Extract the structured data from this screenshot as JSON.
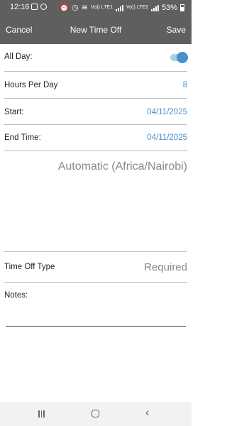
{
  "status_bar": {
    "time": "12:16",
    "battery": "53%",
    "net_label_1": "Vo)) LTE1",
    "net_label_2": "Vo)) LTE2"
  },
  "header": {
    "cancel_label": "Cancel",
    "title": "New Time Off",
    "save_label": "Save"
  },
  "form": {
    "all_day": {
      "label": "All Day:",
      "checked": true
    },
    "hours_per_day": {
      "label": "Hours Per Day",
      "value": "8"
    },
    "start": {
      "label": "Start:",
      "value": "04/11/2025"
    },
    "end": {
      "label": "End Time:",
      "value": "04/11/2025"
    },
    "timezone": "Automatic (Africa/Nairobi)",
    "time_off_type": {
      "label": "Time Off Type",
      "placeholder": "Required"
    },
    "notes": {
      "label": "Notes:",
      "value": ""
    }
  },
  "colors": {
    "header_bg": "#5f5f5f",
    "accent": "#4a90c9",
    "muted_text": "#8a8a8a"
  },
  "icons": {
    "status_left": [
      "image-icon",
      "chat-icon"
    ],
    "status_right": [
      "alarm-icon",
      "clock-icon",
      "wifi-icon",
      "signal-icon",
      "battery-icon"
    ],
    "nav": [
      "recents-icon",
      "home-icon",
      "back-icon"
    ]
  }
}
